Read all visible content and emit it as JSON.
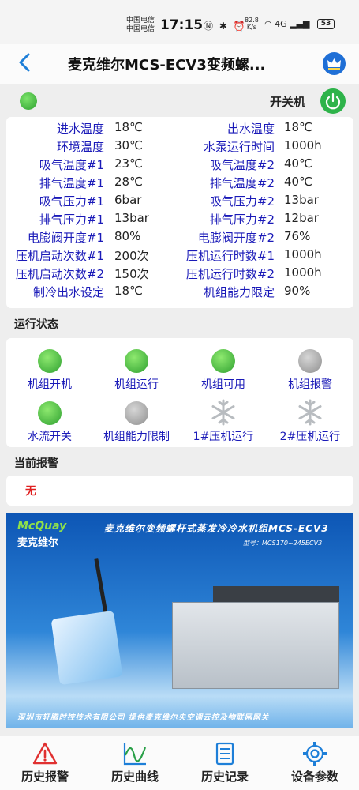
{
  "statusbar": {
    "carrier_1": "中国电信",
    "carrier_2": "中国电信",
    "time": "17:15",
    "speed_value": "82.8",
    "speed_unit": "K/s",
    "signal": "4G",
    "battery": "53"
  },
  "header": {
    "back_icon": "chevron-left-icon",
    "title": "麦克维尔MCS-ECV3变频螺...",
    "vip_icon": "crown-icon"
  },
  "power": {
    "label": "开关机",
    "status": "on",
    "status_color": "#3cb043"
  },
  "params": [
    {
      "l1": "进水温度",
      "v1": "18℃",
      "l2": "出水温度",
      "v2": "18℃"
    },
    {
      "l1": "环境温度",
      "v1": "30℃",
      "l2": "水泵运行时间",
      "v2": "1000h"
    },
    {
      "l1": "吸气温度#1",
      "v1": "23℃",
      "l2": "吸气温度#2",
      "v2": "40℃"
    },
    {
      "l1": "排气温度#1",
      "v1": "28℃",
      "l2": "排气温度#2",
      "v2": "40℃"
    },
    {
      "l1": "吸气压力#1",
      "v1": "6bar",
      "l2": "吸气压力#2",
      "v2": "13bar"
    },
    {
      "l1": "排气压力#1",
      "v1": "13bar",
      "l2": "排气压力#2",
      "v2": "12bar"
    },
    {
      "l1": "电膨阀开度#1",
      "v1": "80%",
      "l2": "电膨阀开度#2",
      "v2": "76%"
    },
    {
      "l1": "压机启动次数#1",
      "v1": "200次",
      "l2": "压机运行时数#1",
      "v2": "1000h"
    },
    {
      "l1": "压机启动次数#2",
      "v1": "150次",
      "l2": "压机运行时数#2",
      "v2": "1000h"
    },
    {
      "l1": "制冷出水设定",
      "v1": "18℃",
      "l2": "机组能力限定",
      "v2": "90%"
    }
  ],
  "run_status": {
    "heading": "运行状态",
    "items": [
      {
        "label": "机组开机",
        "state": "green"
      },
      {
        "label": "机组运行",
        "state": "green"
      },
      {
        "label": "机组可用",
        "state": "green"
      },
      {
        "label": "机组报警",
        "state": "grey"
      },
      {
        "label": "水流开关",
        "state": "green"
      },
      {
        "label": "机组能力限制",
        "state": "grey"
      },
      {
        "label": "1#压机运行",
        "state": "snowflake"
      },
      {
        "label": "2#压机运行",
        "state": "snowflake"
      }
    ]
  },
  "alarm": {
    "heading": "当前报警",
    "value": "无"
  },
  "banner": {
    "logo_en": "McQuay",
    "logo_cn": "麦克维尔",
    "title": "麦克维尔变频螺杆式蒸发冷冷水机组MCS-ECV3",
    "model": "型号：MCS170~245ECV3",
    "footer": "深圳市轩腾时控技术有限公司    提供麦克维尔央空调云控及物联网网关"
  },
  "tabs": [
    {
      "label": "历史报警",
      "icon": "warning-icon"
    },
    {
      "label": "历史曲线",
      "icon": "chart-line-icon"
    },
    {
      "label": "历史记录",
      "icon": "document-list-icon"
    },
    {
      "label": "设备参数",
      "icon": "gear-icon"
    }
  ],
  "colors": {
    "label_blue": "#1a1ab8",
    "accent_blue": "#1e7fd8",
    "alarm_red": "#e02020",
    "tab_icon_red": "#e03030",
    "tab_icon_blue": "#1e7fd8"
  }
}
